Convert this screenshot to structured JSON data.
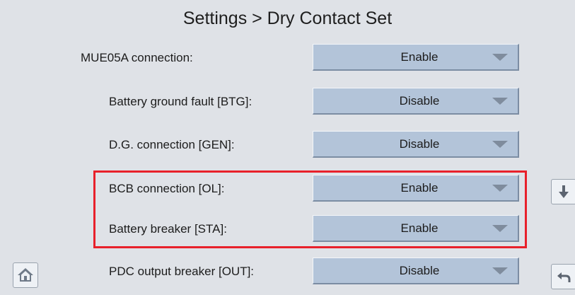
{
  "title": "Settings > Dry Contact Set",
  "rows": [
    {
      "label": "MUE05A connection:",
      "value": "Enable"
    },
    {
      "label": "Battery ground fault [BTG]:",
      "value": "Disable"
    },
    {
      "label": "D.G. connection [GEN]:",
      "value": "Disable"
    },
    {
      "label": "BCB connection [OL]:",
      "value": "Enable"
    },
    {
      "label": "Battery breaker [STA]:",
      "value": "Enable"
    },
    {
      "label": "PDC output breaker [OUT]:",
      "value": "Disable"
    }
  ],
  "icons": {
    "home": "home-icon",
    "scroll_down": "arrow-down-icon",
    "back": "back-arrow-icon",
    "dropdown": "chevron-down-icon"
  },
  "colors": {
    "background": "#dfe2e7",
    "dropdown_fill": "#b3c4d9",
    "highlight_border": "#e8212b"
  }
}
